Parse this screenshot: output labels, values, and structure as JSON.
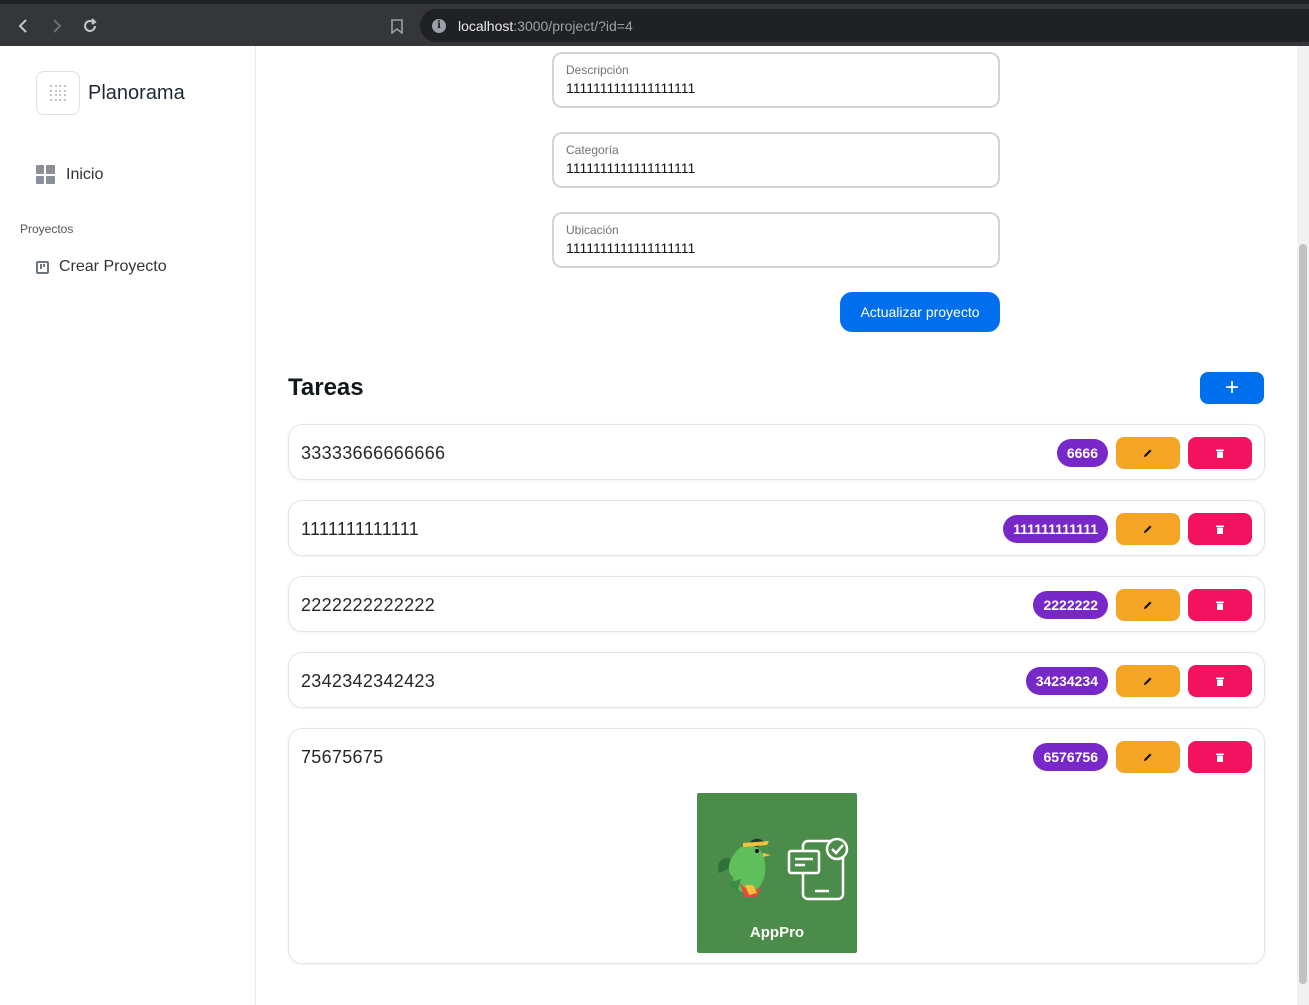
{
  "browser": {
    "url_host": "localhost",
    "url_rest": ":3000/project/?id=4"
  },
  "sidebar": {
    "app_name": "Planorama",
    "home_label": "Inicio",
    "section_label": "Proyectos",
    "create_label": "Crear Proyecto"
  },
  "form": {
    "description": {
      "label": "Descripción",
      "value": "1111111111111111111"
    },
    "category": {
      "label": "Categoría",
      "value": "1111111111111111111"
    },
    "location": {
      "label": "Ubicación",
      "value": "1111111111111111111"
    },
    "submit_label": "Actualizar proyecto"
  },
  "tasks": {
    "title": "Tareas",
    "add_label": "+",
    "items": [
      {
        "name": "33333666666666",
        "chip": "6666"
      },
      {
        "name": "1111111111111",
        "chip": "111111111111"
      },
      {
        "name": "2222222222222",
        "chip": "2222222"
      },
      {
        "name": "2342342342423",
        "chip": "34234234"
      },
      {
        "name": "75675675",
        "chip": "6576756",
        "image_caption": "AppPro"
      }
    ]
  },
  "colors": {
    "primary": "#006fee",
    "chip": "#7828c8",
    "edit": "#f5a524",
    "delete": "#f31260",
    "image_bg": "#4c8c4a"
  }
}
